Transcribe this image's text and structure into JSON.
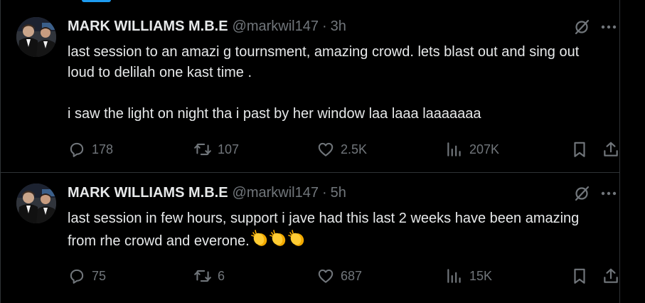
{
  "feed": {
    "tweets": [
      {
        "author": {
          "name": "MARK WILLIAMS M.B.E",
          "handle": "@markwil147",
          "separator": "·",
          "time": "3h"
        },
        "paragraphs": [
          "last session to an amazi g tournsment, amazing crowd. lets blast out and sing out loud to delilah one kast time .",
          "i saw the light on night tha i past by her window laa laaa laaaaaaa"
        ],
        "emojis": [],
        "stats": {
          "replies": "178",
          "reposts": "107",
          "likes": "2.5K",
          "views": "207K"
        }
      },
      {
        "author": {
          "name": "MARK WILLIAMS M.B.E",
          "handle": "@markwil147",
          "separator": "·",
          "time": "5h"
        },
        "paragraphs": [
          "last session in few hours, support i jave had this last 2 weeks have been amazing from rhe crowd and everone."
        ],
        "emojis": [
          "clapping-hands",
          "clapping-hands",
          "clapping-hands"
        ],
        "stats": {
          "replies": "75",
          "reposts": "6",
          "likes": "687",
          "views": "15K"
        }
      }
    ]
  },
  "icons": {
    "reply": "speech-bubble-icon",
    "repost": "repost-arrows-icon",
    "like": "heart-icon",
    "views": "bar-chart-icon",
    "bookmark": "bookmark-icon",
    "share": "share-upload-icon",
    "grok": "grok-slash-icon",
    "more": "more-dots-icon"
  },
  "colors": {
    "background": "#000000",
    "text": "#e7e9ea",
    "muted": "#71767b",
    "divider": "#2f3336",
    "accent": "#1d9bf0"
  }
}
